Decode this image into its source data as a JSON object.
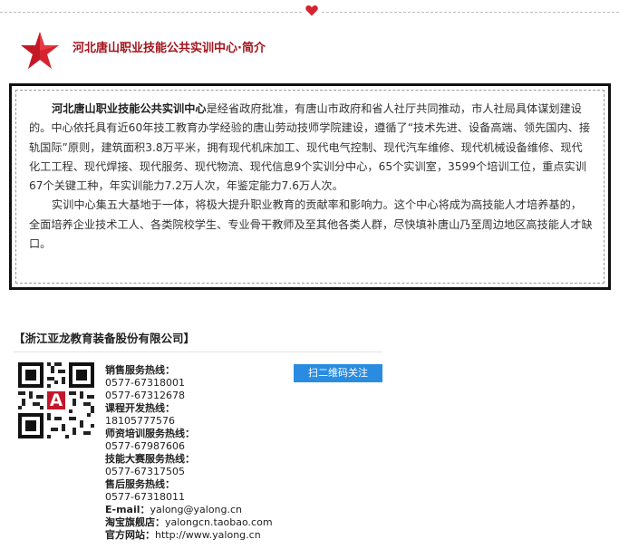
{
  "header": {
    "title": "河北唐山职业技能公共实训中心·简介"
  },
  "intro": {
    "p1_bold": "河北唐山职业技能公共实训中心",
    "p1_rest": "是经省政府批准，有唐山市政府和省人社厅共同推动，市人社局具体谋划建设的。中心依托具有近60年技工教育办学经验的唐山劳动技师学院建设，遵循了“技术先进、设备高端、领先国内、接轨国际”原则，建筑面积3.8万平米，拥有现代机床加工、现代电气控制、现代汽车维修、现代机械设备维修、现代化工工程、现代焊接、现代服务、现代物流、现代信息9个实训分中心，65个实训室，3599个培训工位，重点实训67个关键工种，年实训能力7.2万人次，年鉴定能力7.6万人次。",
    "p2": "实训中心集五大基地于一体，将极大提升职业教育的贡献率和影响力。这个中心将成为高技能人才培养基的，全面培养企业技术工人、各类院校学生、专业骨干教师及至其他各类人群，尽快填补唐山乃至周边地区高技能人才缺口。"
  },
  "company": {
    "title": "【浙江亚龙教育装备股份有限公司】",
    "scan_button": "扫二维码关注",
    "contacts": [
      {
        "label": "销售服务热线：",
        "value": ""
      },
      {
        "label": "",
        "value": "0577-67318001"
      },
      {
        "label": "",
        "value": "0577-67312678"
      },
      {
        "label": "课程开发热线：",
        "value": ""
      },
      {
        "label": "",
        "value": "18105777576"
      },
      {
        "label": "师资培训服务热线：",
        "value": ""
      },
      {
        "label": "",
        "value": "0577-67987606"
      },
      {
        "label": "技能大赛服务热线：",
        "value": ""
      },
      {
        "label": "",
        "value": "0577-67317505"
      },
      {
        "label": "售后服务热线：",
        "value": ""
      },
      {
        "label": "",
        "value": "0577-67318011"
      },
      {
        "label": "E-mail：",
        "value": "yalong@yalong.cn"
      },
      {
        "label": "淘宝旗舰店：",
        "value": "yalongcn.taobao.com"
      },
      {
        "label": "官方网站：",
        "value": "http://www.yalong.cn"
      }
    ]
  },
  "colors": {
    "title_red": "#a3141d",
    "star_red": "#d7232f",
    "button_blue": "#2a8ce0"
  },
  "icons": {
    "divider": "heart-icon",
    "title": "star-icon",
    "company": "qr-code-icon"
  }
}
